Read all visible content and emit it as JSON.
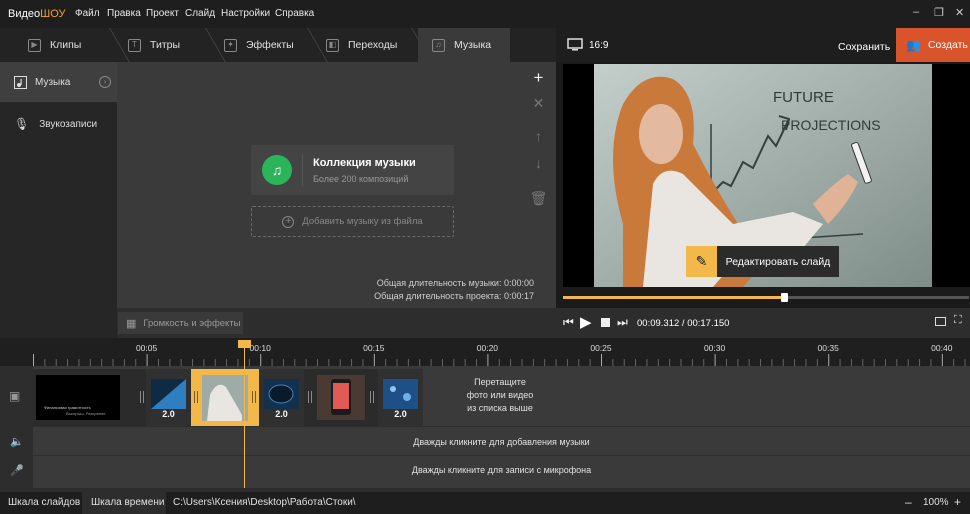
{
  "app": {
    "logo_part1": "Видео",
    "logo_part2": "ШОУ"
  },
  "menu": [
    "Файл",
    "Правка",
    "Проект",
    "Слайд",
    "Настройки",
    "Справка"
  ],
  "window_controls": {
    "minimize": "–",
    "restore": "❐",
    "close": "✕"
  },
  "tabs": [
    {
      "label": "Клипы",
      "icon": "play-icon"
    },
    {
      "label": "Титры",
      "icon": "text-icon"
    },
    {
      "label": "Эффекты",
      "icon": "effects-icon"
    },
    {
      "label": "Переходы",
      "icon": "transitions-icon"
    },
    {
      "label": "Музыка",
      "icon": "music-note-icon",
      "active": true
    }
  ],
  "preview_header": {
    "aspect_ratio": "16:9",
    "save_label": "Сохранить",
    "create_label": "Создать"
  },
  "sidebar": [
    {
      "label": "Музыка",
      "icon": "music-library-icon",
      "active": true
    },
    {
      "label": "Звукозаписи",
      "icon": "microphone-icon"
    }
  ],
  "music": {
    "collection_title": "Коллекция музыки",
    "collection_subtitle": "Более 200 композиций",
    "add_from_file": "Добавить музыку из файла",
    "total_music": "Общая длительность музыки: 0:00:00",
    "total_project": "Общая длительность проекта: 0:00:17",
    "volume_button": "Громкость и эффекты"
  },
  "preview": {
    "board_text_line1": "FUTURE",
    "board_text_line2": "PROJECTIONS",
    "edit_slide_label": "Редактировать слайд",
    "progress_fraction": 0.545,
    "time_current": "00:09.312",
    "time_sep": " / ",
    "time_total": "00:17.150"
  },
  "timeline": {
    "tick_labels": [
      "00:05",
      "00:10",
      "00:15",
      "00:20",
      "00:25",
      "00:30",
      "00:35",
      "00:40"
    ],
    "slide1_caption_line1": "Финансовая грамотность",
    "slide1_caption_line2": "Выигрыш. Разорение",
    "transition_durations": [
      "2.0",
      "2.0",
      "2.0"
    ],
    "drop_hint": [
      "Перетащите",
      "фото или видео",
      "из списка выше"
    ],
    "music_row_hint": "Дважды кликните для добавления музыки",
    "mic_row_hint": "Дважды кликните для записи с микрофона"
  },
  "status": {
    "slides_tab": "Шкала слайдов",
    "timeline_tab": "Шкала времени",
    "path": "C:\\Users\\Ксения\\Desktop\\Работа\\Стоки\\",
    "zoom_minus": "–",
    "zoom_value": "100%",
    "zoom_plus": "+"
  },
  "colors": {
    "accent": "#f3b84a",
    "create_button": "#d9532b",
    "music_green": "#2bb55a"
  }
}
